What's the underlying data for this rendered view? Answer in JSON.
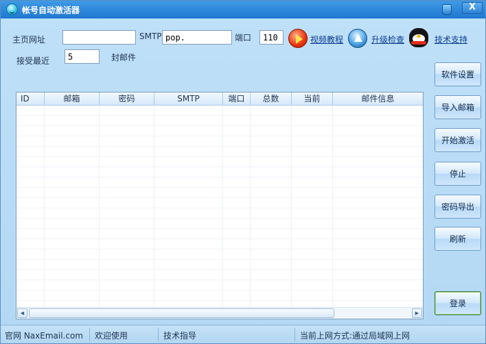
{
  "window": {
    "title": "帐号自动激活器",
    "close_label": "X"
  },
  "form": {
    "homepage_label": "主页网址",
    "homepage_value": "",
    "smtp_label": "SMTP",
    "smtp_value": "pop.",
    "port_label": "端口",
    "port_value": "110",
    "recent_label": "接受最近",
    "recent_value": "5",
    "recent_suffix": "封邮件"
  },
  "links": {
    "video": "视频教程",
    "upgrade": "升级检查",
    "support": "技术支持"
  },
  "table": {
    "columns": [
      "ID",
      "邮箱",
      "密码",
      "SMTP",
      "端口",
      "总数",
      "当前",
      "邮件信息"
    ],
    "rows": []
  },
  "buttons": {
    "settings": "软件设置",
    "import": "导入邮箱",
    "start": "开始激活",
    "stop": "停止",
    "export": "密码导出",
    "refresh": "刷新",
    "login": "登录"
  },
  "status": {
    "site": "官网 NaxEmail.com",
    "welcome": "欢迎使用",
    "guide": "技术指导",
    "network": "当前上网方式:通过局域网上网"
  },
  "scrollbar": {
    "left_arrow": "◀",
    "right_arrow": "▶"
  },
  "icons": {
    "app": "app-smiley-icon",
    "skin": "skin-icon",
    "video": "play-video-icon",
    "upgrade": "upgrade-arrow-icon",
    "support": "qq-penguin-icon"
  },
  "colors": {
    "title_bar": "#2d87dc",
    "window_bg": "#b9dcf5",
    "link": "#0b3c8c"
  }
}
